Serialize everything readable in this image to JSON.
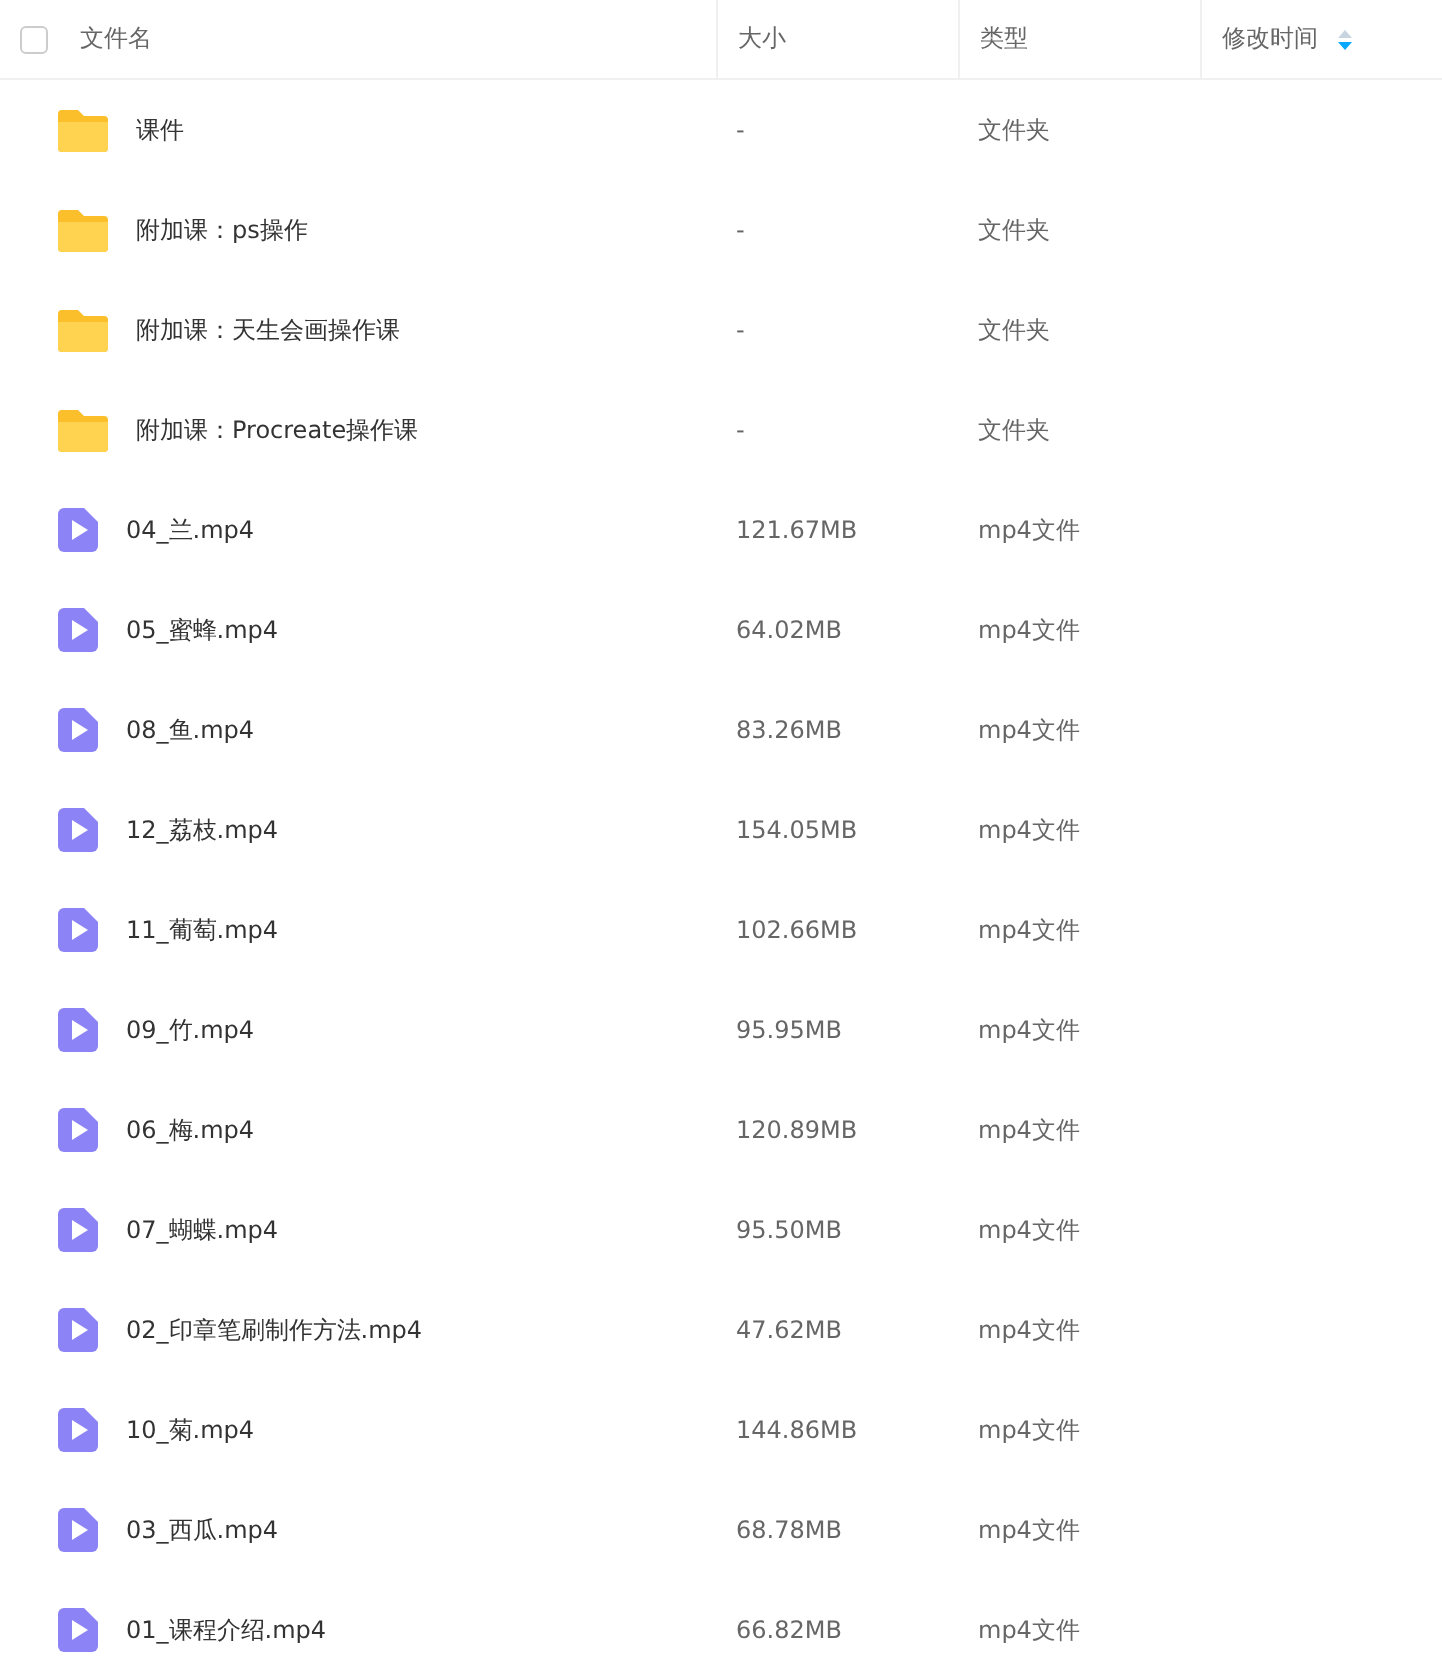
{
  "header": {
    "select_all": {
      "checked": false
    },
    "columns": [
      "文件名",
      "大小",
      "类型",
      "修改时间"
    ]
  },
  "rows": [
    {
      "kind": "folder",
      "name": "课件",
      "size": "-",
      "type": "文件夹"
    },
    {
      "kind": "folder",
      "name": "附加课：ps操作",
      "size": "-",
      "type": "文件夹"
    },
    {
      "kind": "folder",
      "name": "附加课：天生会画操作课",
      "size": "-",
      "type": "文件夹"
    },
    {
      "kind": "folder",
      "name": "附加课：Procreate操作课",
      "size": "-",
      "type": "文件夹"
    },
    {
      "kind": "video",
      "name": "04_兰.mp4",
      "size": "121.67MB",
      "type": "mp4文件"
    },
    {
      "kind": "video",
      "name": "05_蜜蜂.mp4",
      "size": "64.02MB",
      "type": "mp4文件"
    },
    {
      "kind": "video",
      "name": "08_鱼.mp4",
      "size": "83.26MB",
      "type": "mp4文件"
    },
    {
      "kind": "video",
      "name": "12_荔枝.mp4",
      "size": "154.05MB",
      "type": "mp4文件"
    },
    {
      "kind": "video",
      "name": "11_葡萄.mp4",
      "size": "102.66MB",
      "type": "mp4文件"
    },
    {
      "kind": "video",
      "name": "09_竹.mp4",
      "size": "95.95MB",
      "type": "mp4文件"
    },
    {
      "kind": "video",
      "name": "06_梅.mp4",
      "size": "120.89MB",
      "type": "mp4文件"
    },
    {
      "kind": "video",
      "name": "07_蝴蝶.mp4",
      "size": "95.50MB",
      "type": "mp4文件"
    },
    {
      "kind": "video",
      "name": "02_印章笔刷制作方法.mp4",
      "size": "47.62MB",
      "type": "mp4文件"
    },
    {
      "kind": "video",
      "name": "10_菊.mp4",
      "size": "144.86MB",
      "type": "mp4文件"
    },
    {
      "kind": "video",
      "name": "03_西瓜.mp4",
      "size": "68.78MB",
      "type": "mp4文件"
    },
    {
      "kind": "video",
      "name": "01_课程介绍.mp4",
      "size": "66.82MB",
      "type": "mp4文件"
    }
  ]
}
